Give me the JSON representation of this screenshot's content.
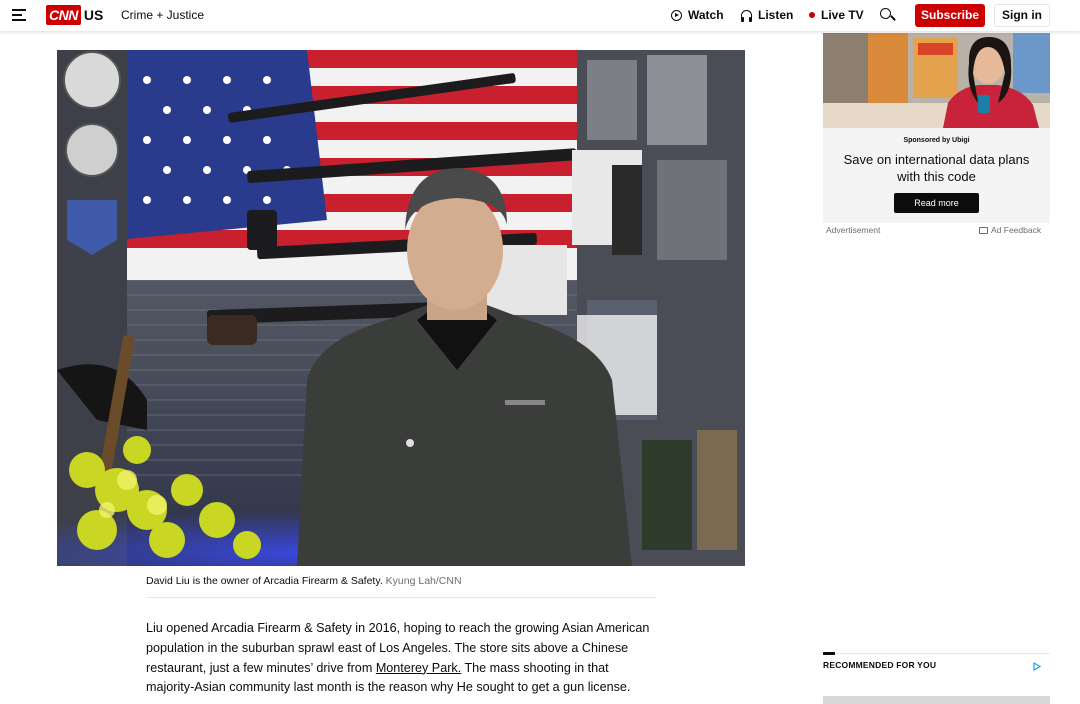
{
  "header": {
    "edition": "US",
    "section": "Crime + Justice",
    "nav": {
      "watch": "Watch",
      "listen": "Listen",
      "live_tv": "Live TV"
    },
    "subscribe": "Subscribe",
    "sign_in": "Sign in",
    "logo_text": "CNN"
  },
  "article": {
    "caption": "David Liu is the owner of Arcadia Firearm & Safety.",
    "caption_credit": "Kyung Lah/CNN",
    "paragraph_before_link": "Liu opened Arcadia Firearm & Safety in 2016, hoping to reach the growing Asian American population in the suburban sprawl east of Los Angeles. The store sits above a Chinese restaurant, just a few minutes’ drive from ",
    "paragraph_link": "Monterey Park.",
    "paragraph_after_link": " The mass shooting in that majority-Asian community last month is the reason why He sought to get a gun license."
  },
  "ad": {
    "sponsor": "Sponsored by Ubigi",
    "headline": "Save on international data plans with this code",
    "button": "Read more",
    "label": "Advertisement",
    "feedback": "Ad Feedback"
  },
  "recommended": {
    "title": "RECOMMENDED FOR YOU"
  },
  "colors": {
    "brand_red": "#cc0000",
    "text": "#0c0c0c",
    "muted": "#6e6e6e"
  },
  "icons": [
    "hamburger-menu-icon",
    "play-icon",
    "headphones-icon",
    "live-dot-icon",
    "search-icon",
    "feedback-icon",
    "adchoices-icon"
  ]
}
